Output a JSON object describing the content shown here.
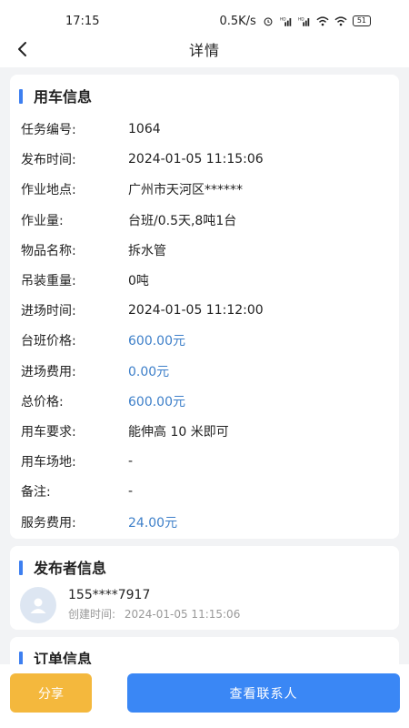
{
  "status_bar": {
    "time": "17:15",
    "network_speed": "0.5K/s",
    "signal_1": "HD",
    "signal_2": "HD",
    "battery": "51"
  },
  "nav": {
    "title": "详情",
    "back_icon": "chevron-left-icon"
  },
  "vehicle_info": {
    "title": "用车信息",
    "rows": [
      {
        "label": "任务编号:",
        "value": "1064"
      },
      {
        "label": "发布时间:",
        "value": "2024-01-05 11:15:06"
      },
      {
        "label": "作业地点:",
        "value": "广州市天河区******"
      },
      {
        "label": "作业量:",
        "value": "台班/0.5天,8吨1台"
      },
      {
        "label": "物品名称:",
        "value": "拆水管"
      },
      {
        "label": "吊装重量:",
        "value": "0吨"
      },
      {
        "label": "进场时间:",
        "value": "2024-01-05 11:12:00"
      },
      {
        "label": "台班价格:",
        "value": "600.00元",
        "price": true
      },
      {
        "label": "进场费用:",
        "value": "0.00元",
        "price": true
      },
      {
        "label": "总价格:",
        "value": "600.00元",
        "price": true
      },
      {
        "label": "用车要求:",
        "value": "能伸高 10 米即可"
      },
      {
        "label": "用车场地:",
        "value": "-"
      },
      {
        "label": "备注:",
        "value": "-"
      },
      {
        "label": "服务费用:",
        "value": "24.00元",
        "price": true
      }
    ]
  },
  "publisher_info": {
    "title": "发布者信息",
    "phone": "155****7917",
    "created_label": "创建时间:",
    "created_time": "2024-01-05 11:15:06"
  },
  "order_info": {
    "title": "订单信息"
  },
  "bottom": {
    "share_label": "分享",
    "contact_label": "查看联系人"
  },
  "colors": {
    "accent": "#3d7ff0",
    "price": "#3d7fc9",
    "share": "#f4b83d",
    "contact": "#3a87f5"
  }
}
